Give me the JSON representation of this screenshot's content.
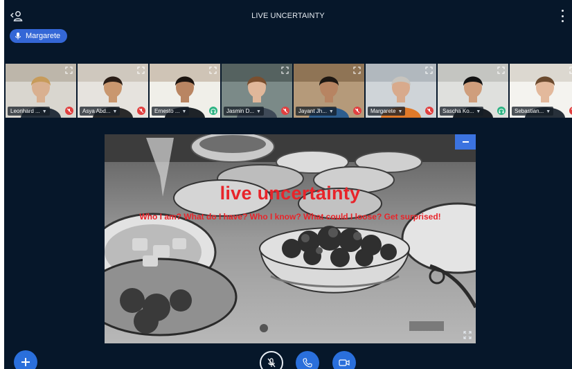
{
  "header": {
    "title": "LIVE UNCERTAINTY",
    "users_icon": "users-toggle-icon",
    "menu_icon": "more-vertical-icon"
  },
  "talking": {
    "name": "Margarete",
    "icon": "microphone-icon"
  },
  "participants": [
    {
      "name": "Leonhard ...",
      "status": "muted",
      "active": false
    },
    {
      "name": "Asya Abd...",
      "status": "muted",
      "active": false
    },
    {
      "name": "Ernesto ...",
      "status": "listen",
      "active": false
    },
    {
      "name": "Jasmin D...",
      "status": "muted",
      "active": false
    },
    {
      "name": "Jayant Jh...",
      "status": "muted",
      "active": false
    },
    {
      "name": "Margarete",
      "status": "muted",
      "active": true
    },
    {
      "name": "Sascha Ko...",
      "status": "listen",
      "active": false
    },
    {
      "name": "Sebastian...",
      "status": "muted",
      "active": false
    }
  ],
  "presentation": {
    "title": "live uncertainty",
    "subtitle": "Who I am? What do I have? Who I know? What could I loose? Get surprised!",
    "minimize_icon": "minimize-icon",
    "fullscreen_icon": "fullscreen-icon"
  },
  "controls": {
    "actions_icon": "plus-icon",
    "mic_icon": "mic-muted-icon",
    "leave_audio_icon": "phone-icon",
    "video_icon": "video-camera-icon"
  },
  "colors": {
    "background": "#06172a",
    "accent": "#2a6fdb",
    "muted": "#e14040",
    "listen": "#2db383",
    "slide_text": "#e8242a"
  }
}
